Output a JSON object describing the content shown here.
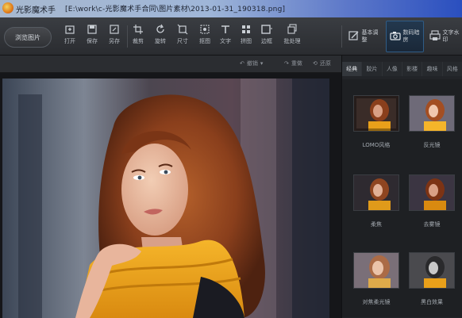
{
  "titlebar": {
    "app_name": "光影魔术手",
    "path": "[E:\\work\\c-光影魔术手合同\\图片素材\\2013-01-31_190318.png]"
  },
  "toolbar": {
    "browse_label": "浏览图片",
    "tools": [
      {
        "label": "打开",
        "icon": "open-icon"
      },
      {
        "label": "保存",
        "icon": "save-icon"
      },
      {
        "label": "另存",
        "icon": "save-as-icon"
      },
      {
        "label": "裁剪",
        "icon": "crop-icon"
      },
      {
        "label": "旋转",
        "icon": "rotate-icon"
      },
      {
        "label": "尺寸",
        "icon": "resize-icon"
      },
      {
        "label": "抠图",
        "icon": "cutout-icon"
      },
      {
        "label": "文字",
        "icon": "text-icon"
      },
      {
        "label": "拼图",
        "icon": "collage-icon"
      },
      {
        "label": "边框",
        "icon": "frame-icon"
      },
      {
        "label": "批处理",
        "icon": "batch-icon"
      }
    ],
    "modes": [
      {
        "label": "基本调整",
        "icon": "adjust-icon"
      },
      {
        "label": "数码暗房",
        "icon": "camera-icon"
      },
      {
        "label": "文字水印",
        "icon": "print-icon"
      }
    ]
  },
  "subbar": {
    "undo_label": "撤销",
    "redo_label": "重做",
    "restore_label": "还原"
  },
  "panel": {
    "tabs": [
      "经典",
      "胶片",
      "人像",
      "影楼",
      "趣味",
      "风格"
    ],
    "active_tab": 0,
    "effects": [
      {
        "label": "LOMO风格"
      },
      {
        "label": "反光镜"
      },
      {
        "label": "柔焦"
      },
      {
        "label": "去雾镜"
      },
      {
        "label": "对焦柔光镜"
      },
      {
        "label": "黑白效果"
      }
    ]
  },
  "colors": {
    "accent": "#2f5c86",
    "scarf": "#e9a01a",
    "hair": "#8a3f1c"
  }
}
